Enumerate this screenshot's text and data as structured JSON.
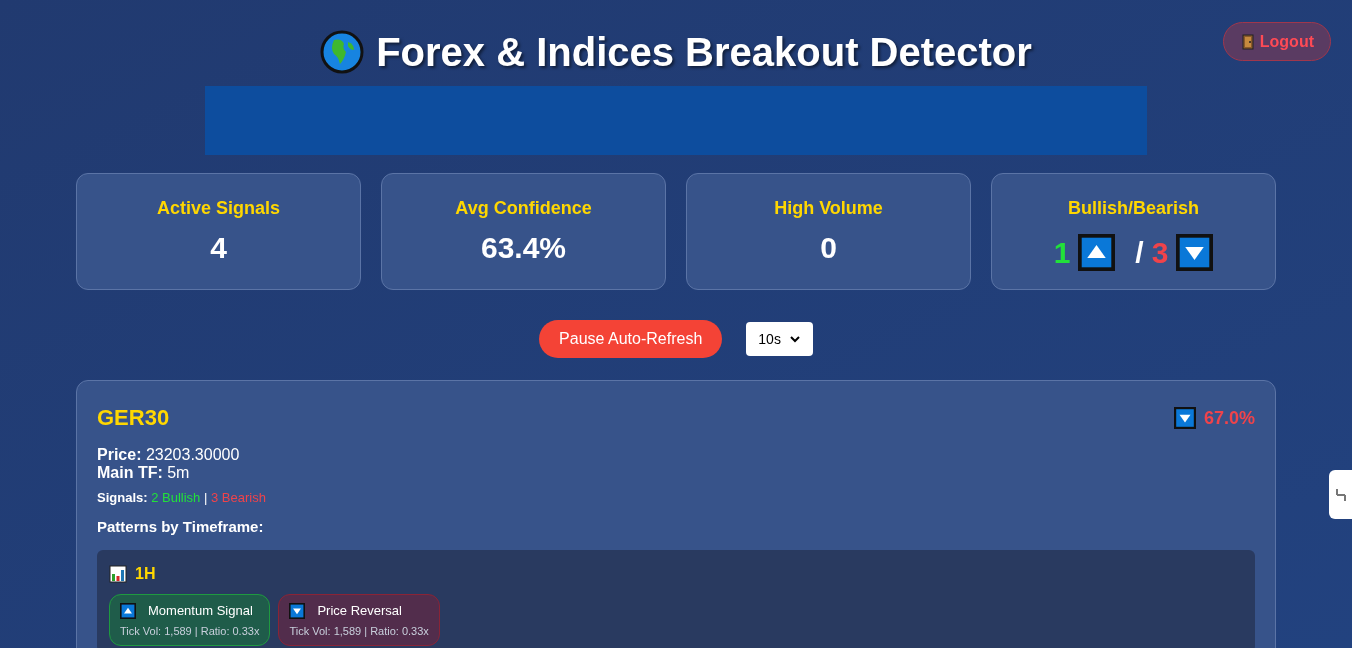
{
  "header": {
    "title": "Forex & Indices Breakout Detector",
    "logout": "Logout"
  },
  "stats": [
    {
      "kind": "value",
      "label": "Active Signals",
      "value": "4"
    },
    {
      "kind": "value",
      "label": "Avg Confidence",
      "value": "63.4%"
    },
    {
      "kind": "value",
      "label": "High Volume",
      "value": "0"
    },
    {
      "kind": "ratio",
      "label": "Bullish/Bearish",
      "bullish": "1",
      "separator": "/",
      "bearish": "3"
    }
  ],
  "controls": {
    "pause_button": "Pause Auto-Refresh",
    "interval": "10s"
  },
  "signal": {
    "symbol": "GER30",
    "kind": "bearish",
    "confidence": "67.0%",
    "price_label": "Price:",
    "price": "23203.30000",
    "tf_label": "Main TF:",
    "tf": "5m",
    "signals_label": "Signals:",
    "bullish": "2 Bullish",
    "divider": "|",
    "bearish": "3 Bearish",
    "patterns_heading": "Patterns by Timeframe:",
    "timeframes": [
      {
        "name": "1H",
        "patterns": [
          {
            "kind": "bullish",
            "name": "Momentum Signal",
            "detail": "Tick Vol: 1,589 | Ratio: 0.33x"
          },
          {
            "kind": "bearish",
            "name": "Price Reversal",
            "detail": "Tick Vol: 1,589 | Ratio: 0.33x"
          }
        ]
      }
    ]
  }
}
